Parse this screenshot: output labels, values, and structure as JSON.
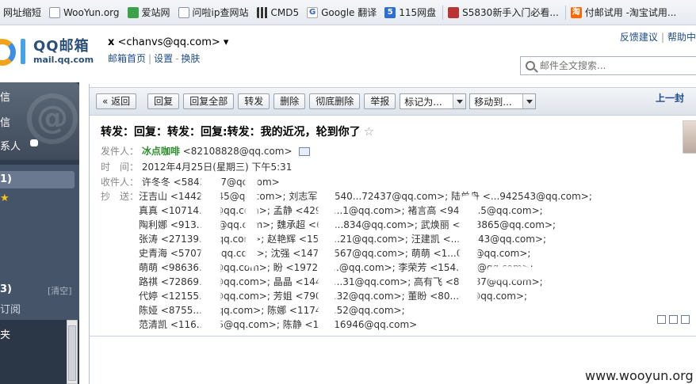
{
  "bookmarks": [
    {
      "label": "网址缩短",
      "icon": "none"
    },
    {
      "label": "WooYun.org",
      "icon": "page-icon"
    },
    {
      "label": "爱站网",
      "icon": "aizhan-icon"
    },
    {
      "label": "问啦ip查网站",
      "icon": "page-icon"
    },
    {
      "label": "CMD5",
      "icon": "grid-icon"
    },
    {
      "label": "Google 翻译",
      "icon": "google-icon"
    },
    {
      "label": "115网盘",
      "icon": "115-icon"
    },
    {
      "label": "S5830新手入门必看...",
      "icon": "samsung-icon"
    },
    {
      "label": "付邮试用 -淘宝试用...",
      "icon": "taobao-icon"
    }
  ],
  "header": {
    "logo_title": "QQ邮箱",
    "logo_domain": "mail.qq.com",
    "account_prefix": "x",
    "account_email": "<chanvs@qq.com>",
    "account_caret": "▾",
    "links": [
      "邮箱首页",
      "设置",
      "换肤"
    ],
    "top_links": [
      "反馈建议",
      "帮助中"
    ],
    "search_placeholder": "邮件全文搜索..."
  },
  "sidebar": {
    "items": [
      "信",
      "信",
      "系人"
    ],
    "folder_count": "1)",
    "star": "★",
    "group_count": "3)",
    "clear": "[清空]",
    "sub_item": "订阅",
    "low_item": "夹"
  },
  "toolbar": {
    "back": "« 返回",
    "reply": "回复",
    "reply_all": "回复全部",
    "forward": "转发",
    "delete": "删除",
    "delete_permanent": "彻底删除",
    "report": "举报",
    "mark_as": "标记为...",
    "move_to": "移动到...",
    "prev": "上一封"
  },
  "message": {
    "subject": "转发：回复：转发：回复:转发：我的近况，轮到你了",
    "star": "☆",
    "from_label": "发件人：",
    "from_name": "冰点咖啡",
    "from_email": "<82108828@qq.com>",
    "time_label": "时　间：",
    "time": "2012年4月25日(星期三) 下午5:31",
    "to_label": "收件人：",
    "to": "许冬冬 <5842...47@qq.com>",
    "cc_label": "抄　送：",
    "cc_lines": [
      "汪吉山 <1442...245@qq.com>; 刘志军 <1540...72437@qq.com>; 陆单舟 <...942543@qq.com>;",
      "真真 <10714...9@qq.com>; 孟静 <42930...1@qq.com>; 褚言高 <9466...5@qq.com>;",
      "陶利娜 <913...52@qq.com>; 魏承超 <635...834@qq.com>; 武焕丽 <...73865@qq.com>;",
      "张涛 <27139...@qq.com>; 赵艳辉 <1548...21@qq.com>; 汪建凯 <...27443@qq.com>;",
      "史青海 <5707...@qq.com>; 沈强 <1475...567@qq.com>; 萌萌 <1...041@qq.com>;",
      "萌萌 <98636...8@qq.com>; 盼 <197246...@qq.com>; 李荣芳 <154...93@qq.com>;",
      "路祺 <72869...4@qq.com>; 晶晶 <14466...31@qq.com>; 高有飞 <8...887@qq.com>;",
      "代婷 <12155...3@qq.com>; 芳姐 <7908...32@qq.com>; 董盼 <80...49@qq.com>;",
      "陈娅 <8755...0@qq.com>; 陈娜 <11747...52@qq.com>;",
      "范清凯 <116...515@qq.com>; 陈静 <15...16946@qq.com>"
    ]
  },
  "watermark": "www.wooyun.org"
}
